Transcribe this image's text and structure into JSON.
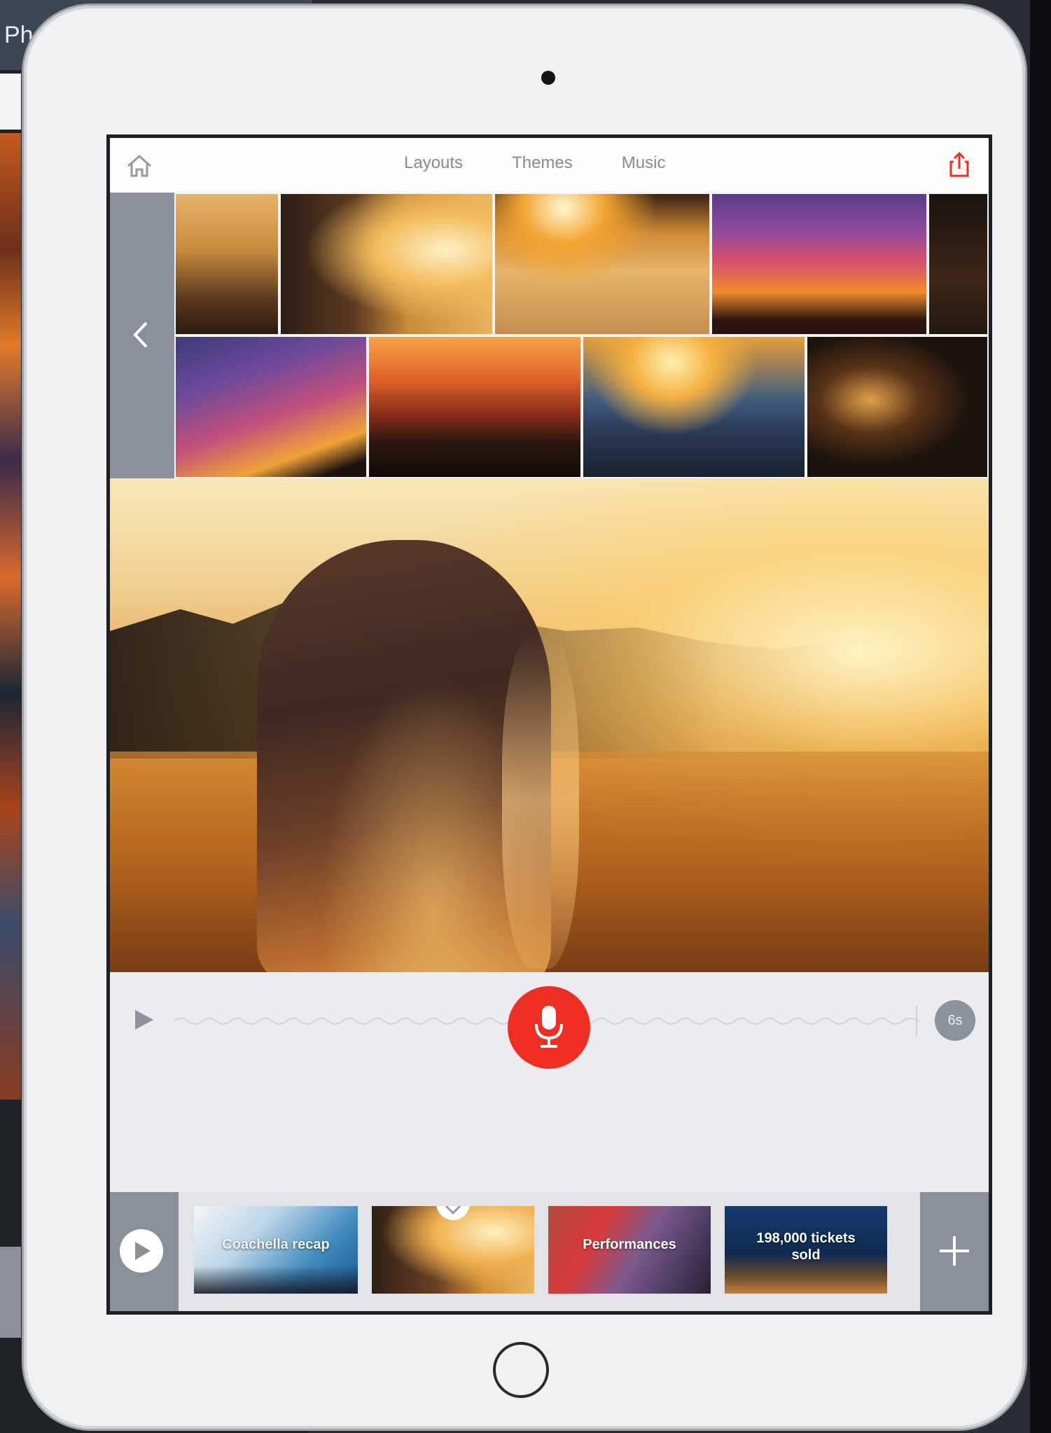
{
  "background_app": {
    "title_fragment": "Ph"
  },
  "nav": {
    "tabs": [
      {
        "label": "Layouts"
      },
      {
        "label": "Themes"
      },
      {
        "label": "Music"
      }
    ]
  },
  "audio": {
    "duration_label": "6s"
  },
  "timeline": {
    "slides": [
      {
        "caption": "Coachella recap"
      },
      {
        "caption": ""
      },
      {
        "caption": "Performances"
      },
      {
        "caption": "198,000 tickets sold"
      }
    ]
  },
  "colors": {
    "accent_red": "#ee2f22",
    "panel_grey": "#8a9099",
    "nav_text": "#8a8a90"
  },
  "icons": [
    "home-icon",
    "share-icon",
    "chevron-left-icon",
    "play-icon",
    "microphone-icon",
    "plus-icon",
    "chevron-down-icon"
  ]
}
